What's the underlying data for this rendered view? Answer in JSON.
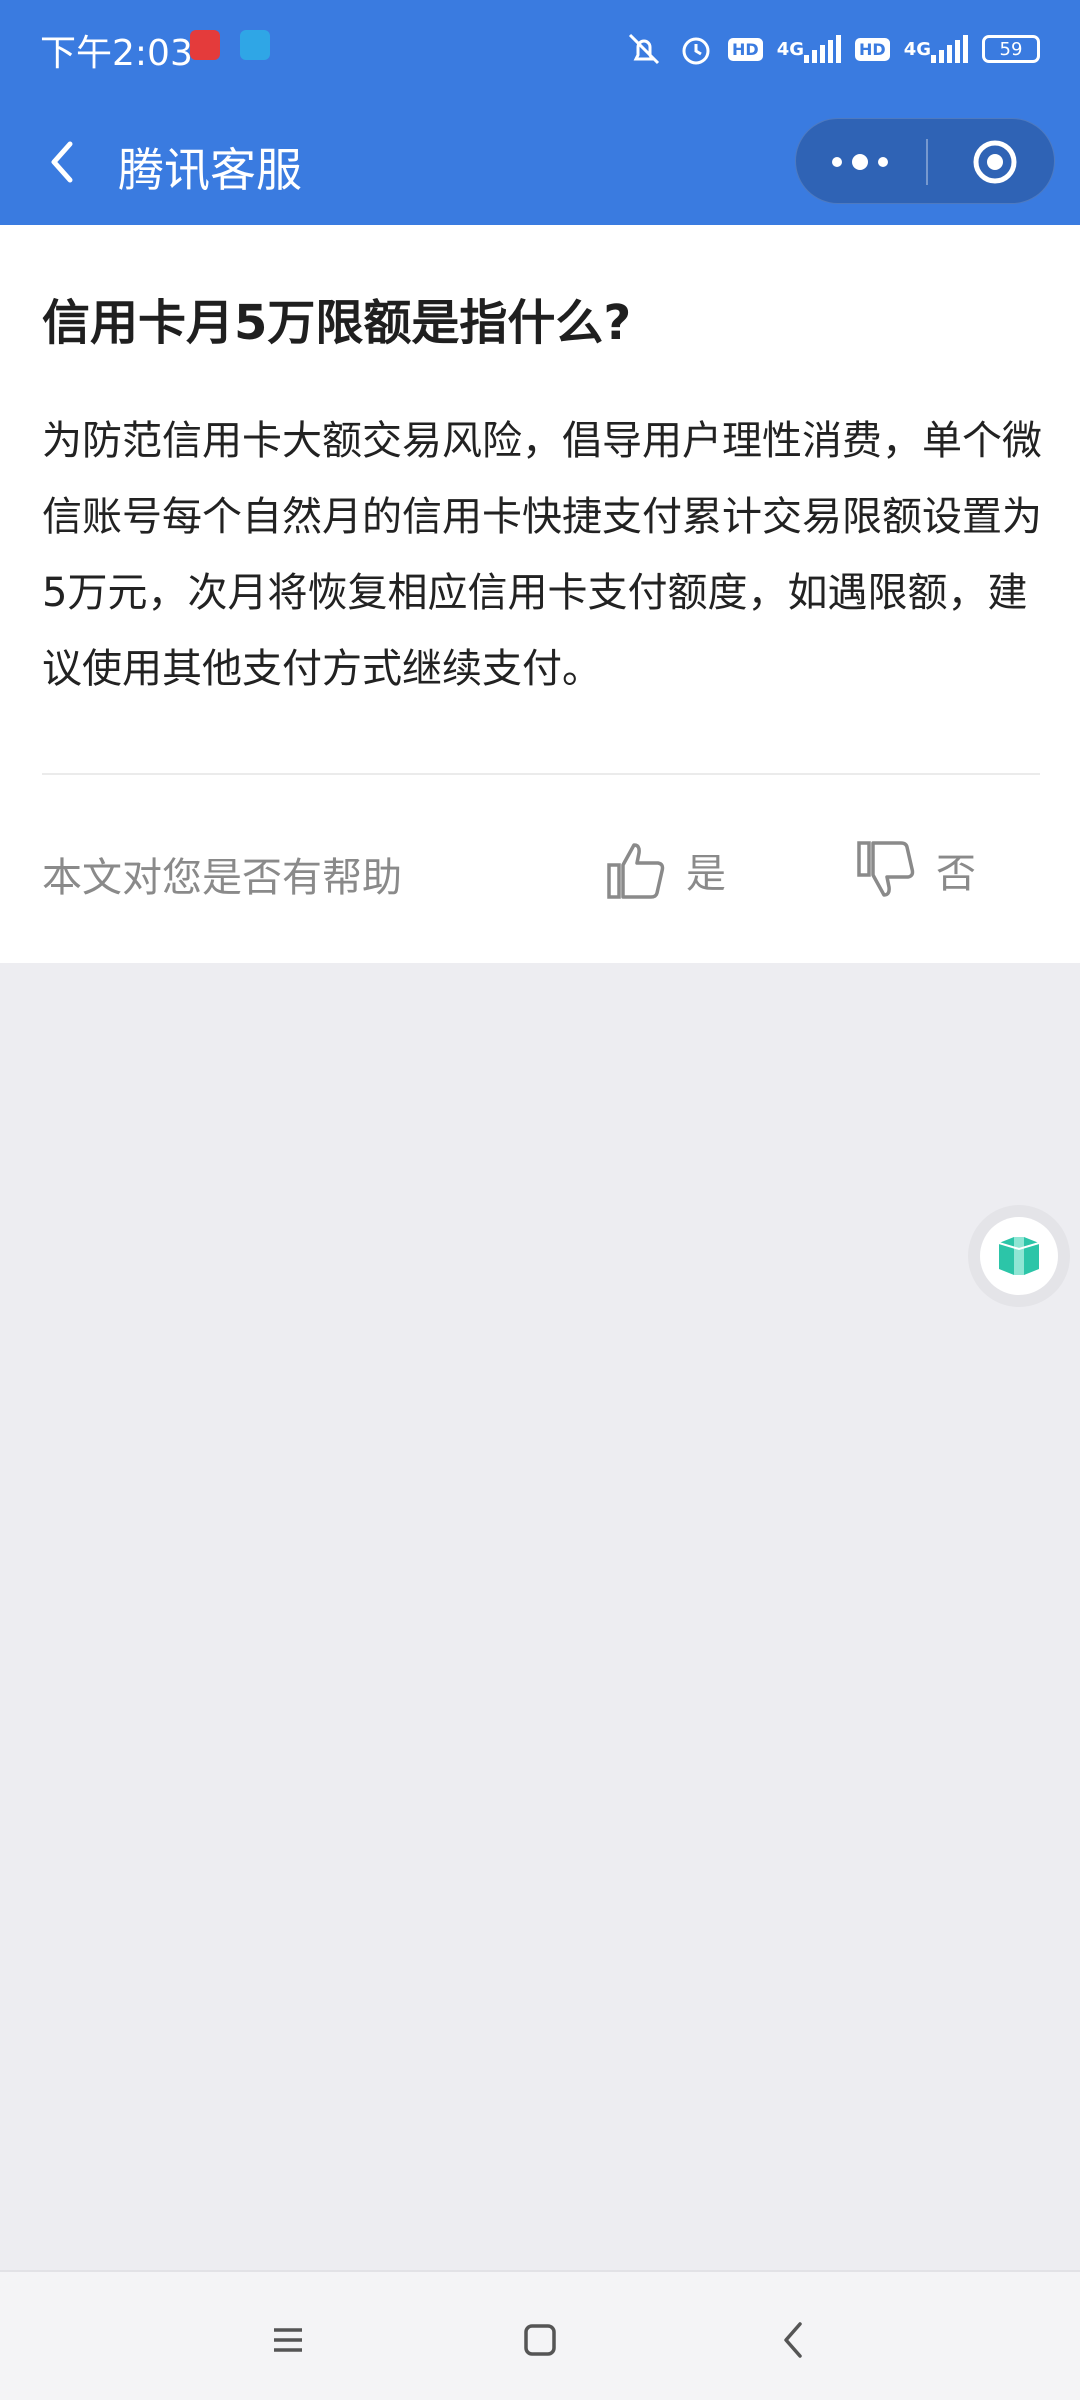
{
  "status_bar": {
    "time": "下午2:03",
    "hd_label": "HD",
    "network_label": "4G",
    "battery_level": "59",
    "icons": [
      "app-notification-icon",
      "app-notification-icon",
      "mute-icon",
      "alarm-icon",
      "hd-icon",
      "signal-icon",
      "hd-icon",
      "signal-icon",
      "battery-icon"
    ]
  },
  "header": {
    "title": "腾讯客服",
    "back_icon": "back-arrow-icon",
    "more_icon": "more-dots-icon",
    "close_icon": "target-close-icon"
  },
  "article": {
    "title": "信用卡月5万限额是指什么?",
    "body": "为防范信用卡大额交易风险，倡导用户理性消费，单个微信账号每个自然月的信用卡快捷支付累计交易限额设置为5万元，次月将恢复相应信用卡支付额度，如遇限额，建议使用其他支付方式继续支付。"
  },
  "feedback": {
    "question": "本文对您是否有帮助",
    "yes_label": "是",
    "no_label": "否",
    "yes_icon": "thumbs-up-icon",
    "no_icon": "thumbs-down-icon"
  },
  "floating_button": {
    "icon": "cube-assistant-icon",
    "color": "#2cc5a8"
  },
  "nav_bar": {
    "icons": [
      "menu-icon",
      "home-icon",
      "back-icon"
    ]
  },
  "colors": {
    "accent": "#3a7be0",
    "capsule": "#2f63b5",
    "background": "#ededf1"
  }
}
